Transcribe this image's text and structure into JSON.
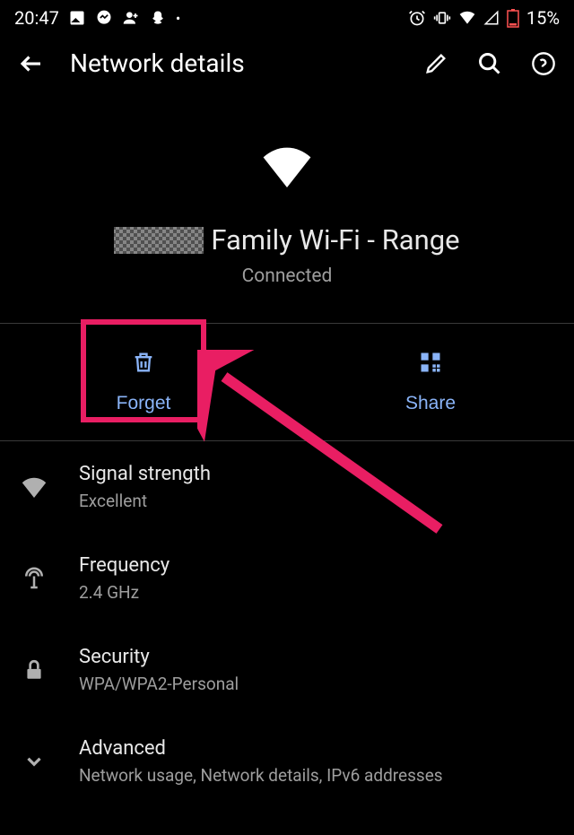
{
  "status_bar": {
    "time": "20:47",
    "battery_percent": "15%"
  },
  "app_bar": {
    "title": "Network details"
  },
  "network": {
    "name_visible": "Family Wi-Fi - Range",
    "status": "Connected"
  },
  "actions": {
    "forget": "Forget",
    "share": "Share"
  },
  "details": {
    "signal": {
      "title": "Signal strength",
      "value": "Excellent"
    },
    "frequency": {
      "title": "Frequency",
      "value": "2.4 GHz"
    },
    "security": {
      "title": "Security",
      "value": "WPA/WPA2-Personal"
    },
    "advanced": {
      "title": "Advanced",
      "value": "Network usage, Network details, IPv6 addresses"
    }
  },
  "annotation": {
    "highlight_target": "forget-button"
  }
}
